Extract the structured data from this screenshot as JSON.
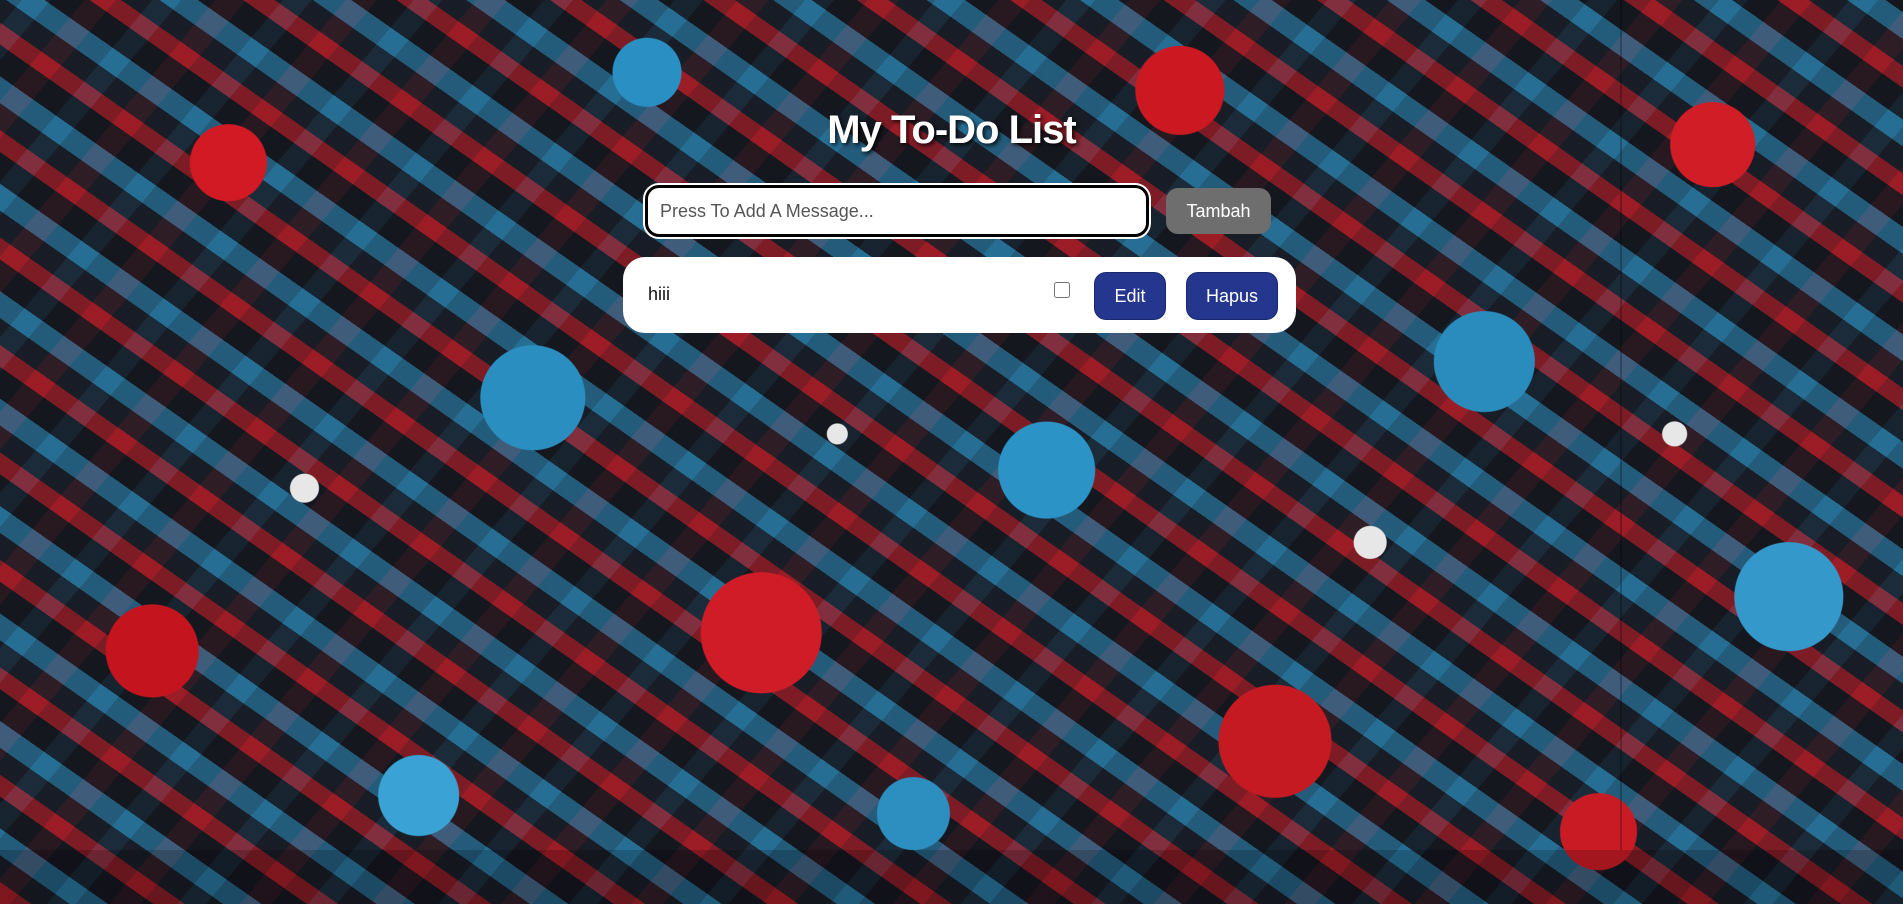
{
  "header": {
    "title": "My To-Do List"
  },
  "input": {
    "value": "",
    "placeholder": "Press To Add A Message..."
  },
  "add_button": {
    "label": "Tambah"
  },
  "todos": [
    {
      "text": "hiii",
      "checked": false,
      "edit_label": "Edit",
      "delete_label": "Hapus"
    }
  ],
  "colors": {
    "title_text": "#ffffff",
    "add_button_bg": "#6e6e6e",
    "action_button_bg": "#25368f",
    "card_bg": "#ffffff",
    "background_red": "#d11a24",
    "background_blue": "#2a8fc0"
  }
}
